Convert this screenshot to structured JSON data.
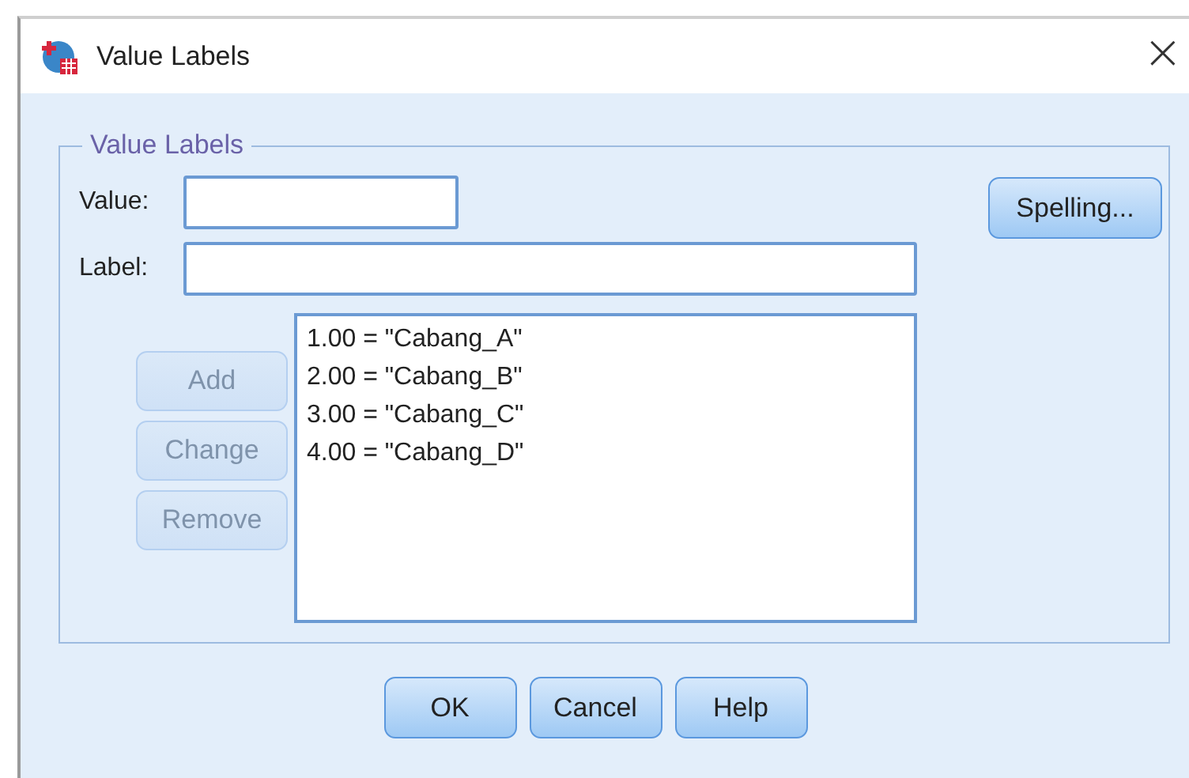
{
  "window": {
    "title": "Value Labels",
    "close": "×"
  },
  "group": {
    "legend": "Value Labels"
  },
  "value_field": {
    "label": "Value:"
  },
  "label_field": {
    "label": "Label:"
  },
  "spelling_button": {
    "label": "Spelling..."
  },
  "side_buttons": [
    {
      "label": "Add",
      "disabled": true
    },
    {
      "label": "Change",
      "disabled": true
    },
    {
      "label": "Remove",
      "disabled": true
    }
  ],
  "labels_list": [
    "1.00 = \"Cabang_A\"",
    "2.00 = \"Cabang_B\"",
    "3.00 = \"Cabang_C\"",
    "4.00 = \"Cabang_D\""
  ],
  "buttons": [
    "OK",
    "Cancel",
    "Help"
  ]
}
